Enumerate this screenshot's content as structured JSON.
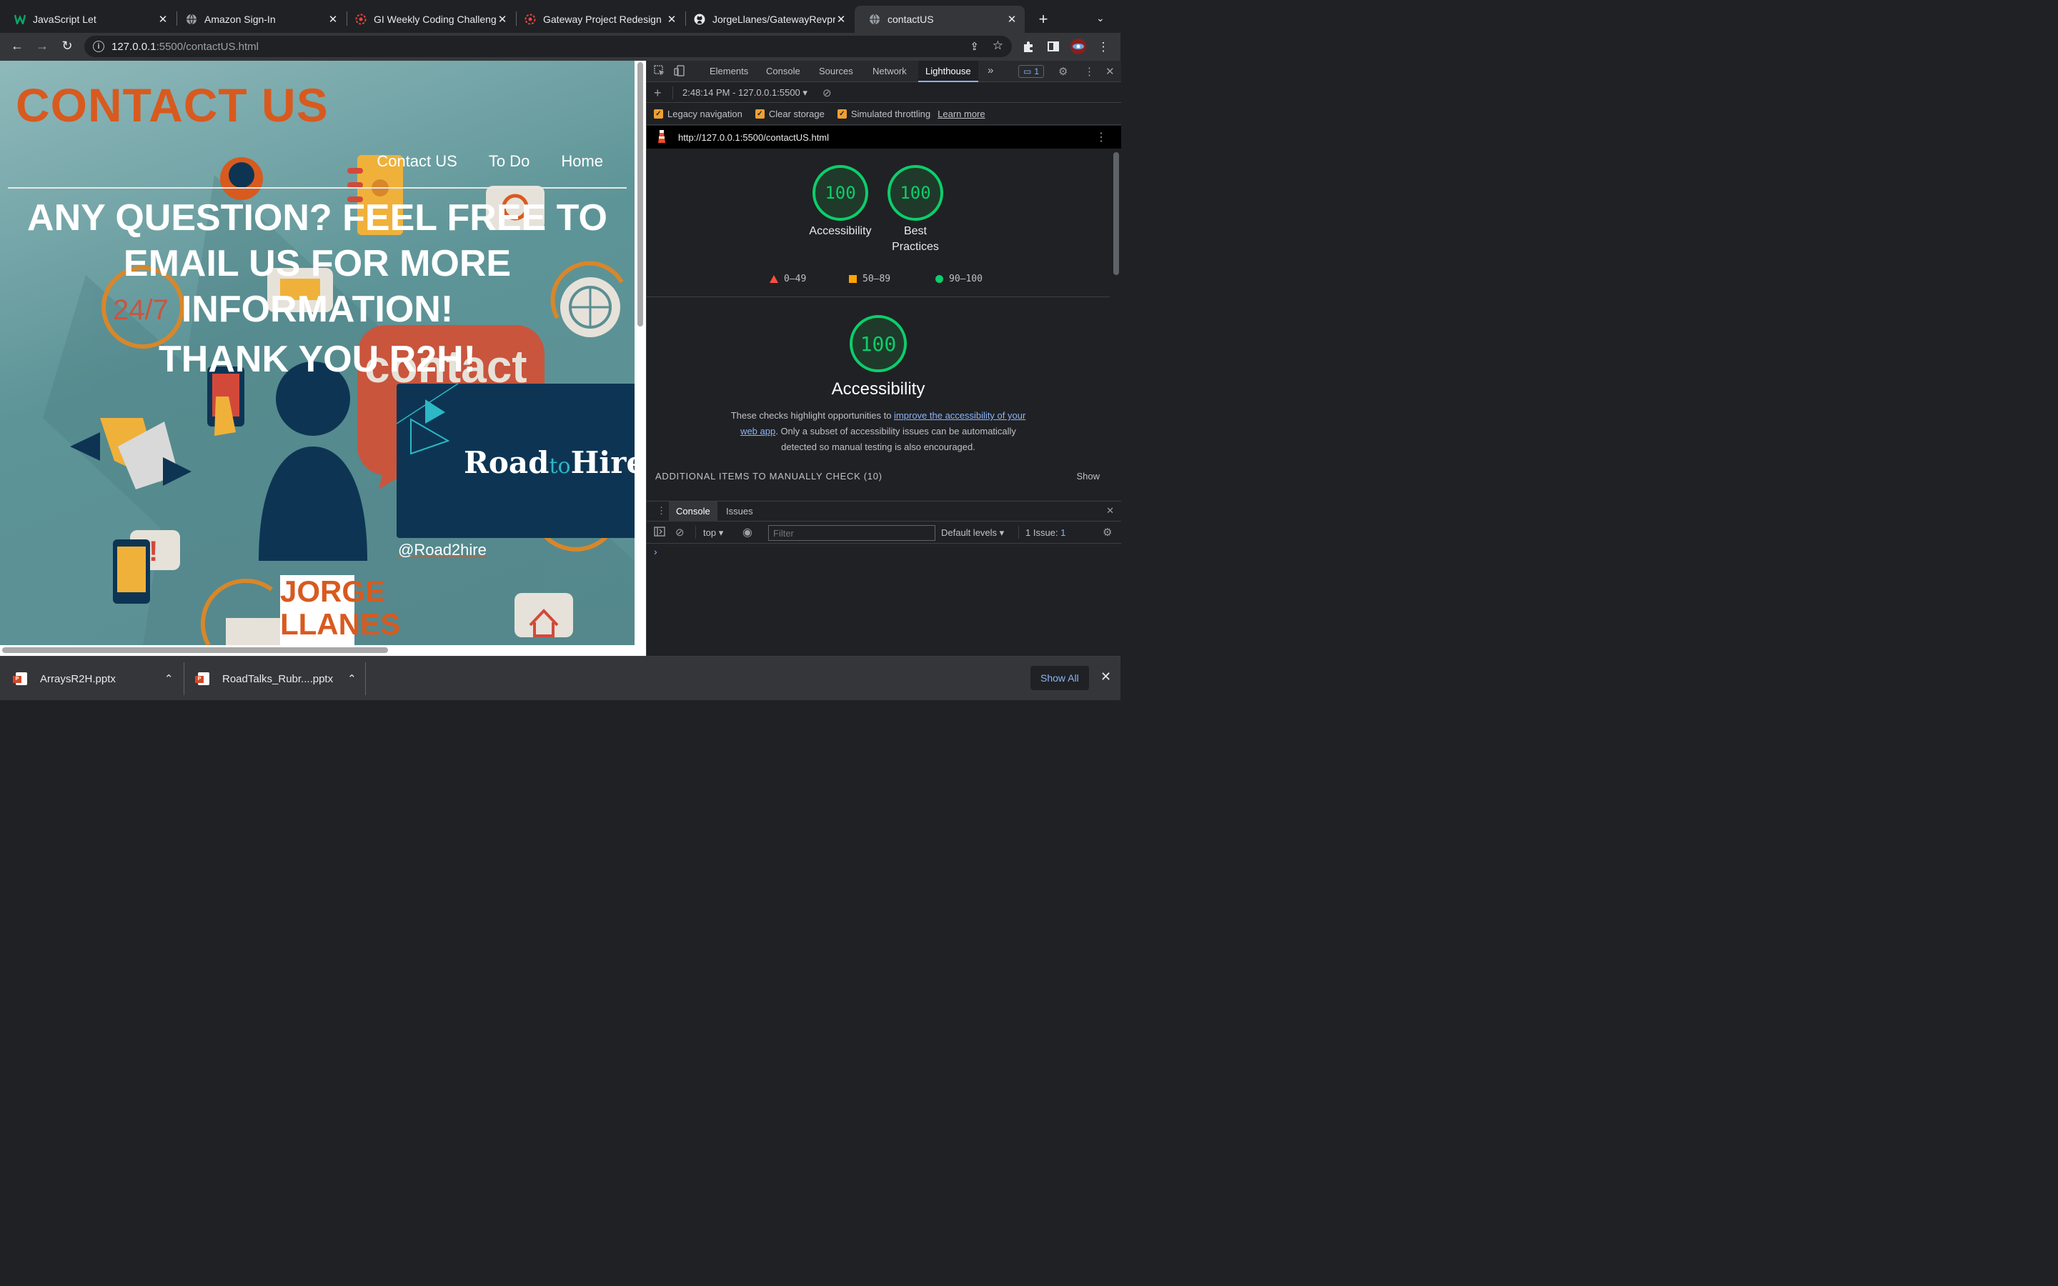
{
  "browser": {
    "tabs": [
      {
        "title": "JavaScript Let",
        "icon": "w3schools-favicon"
      },
      {
        "title": "Amazon Sign-In",
        "icon": "globe-icon"
      },
      {
        "title": "GI Weekly Coding Challeng",
        "icon": "gear-logo-icon"
      },
      {
        "title": "Gateway Project Redesign",
        "icon": "gear-logo-icon"
      },
      {
        "title": "JorgeLlanes/GatewayRevpr",
        "icon": "github-icon"
      },
      {
        "title": "contactUS",
        "icon": "globe-icon",
        "active": true
      }
    ],
    "new_tab": "+",
    "url_host": "127.0.0.1",
    "url_path": ":5500/contactUS.html"
  },
  "page": {
    "title": "CONTACT US",
    "nav": [
      "Contact US",
      "To Do",
      "Home"
    ],
    "headline": "ANY QUESTION? FEEL FREE TO EMAIL US FOR MORE INFORMATION!",
    "thanks": "THANK YOU R2H!",
    "logo_road": "Road",
    "logo_to": "to",
    "logo_hire": "Hire",
    "handle": "@Road2hire",
    "name_line1": "JORGE",
    "name_line2": "LLANES",
    "bg_words": [
      "24/7",
      "contact"
    ]
  },
  "devtools": {
    "tabs": [
      "Elements",
      "Console",
      "Sources",
      "Network",
      "Lighthouse"
    ],
    "active_tab": "Lighthouse",
    "more": "»",
    "issues_badge": "1",
    "run_label": "2:48:14 PM - 127.0.0.1:5500",
    "options": [
      "Legacy navigation",
      "Clear storage",
      "Simulated throttling"
    ],
    "learn_more": "Learn more",
    "report_url": "http://127.0.0.1:5500/contactUS.html",
    "scores": [
      {
        "label": "Accessibility",
        "value": "100"
      },
      {
        "label": "Best Practices",
        "value": "100"
      }
    ],
    "legend": [
      "0–49",
      "50–89",
      "90–100"
    ],
    "section_score": "100",
    "section_title": "Accessibility",
    "desc_pre": "These checks highlight opportunities to ",
    "desc_link": "improve the accessibility of your web app",
    "desc_post": ". Only a subset of accessibility issues can be automatically detected so manual testing is also encouraged.",
    "manual_check": "ADDITIONAL ITEMS TO MANUALLY CHECK (10)",
    "show": "Show",
    "drawer_tabs": [
      "Console",
      "Issues"
    ],
    "context": "top",
    "filter_placeholder": "Filter",
    "levels": "Default levels",
    "issue_count": "1 Issue:",
    "issue_num": "1",
    "prompt": "›"
  },
  "downloads": {
    "items": [
      "ArraysR2H.pptx",
      "RoadTalks_Rubr....pptx"
    ],
    "show_all": "Show All"
  },
  "colors": {
    "accent_orange": "#d85a1f",
    "lighthouse_green": "#0cce6b",
    "navy": "#0d3553"
  }
}
